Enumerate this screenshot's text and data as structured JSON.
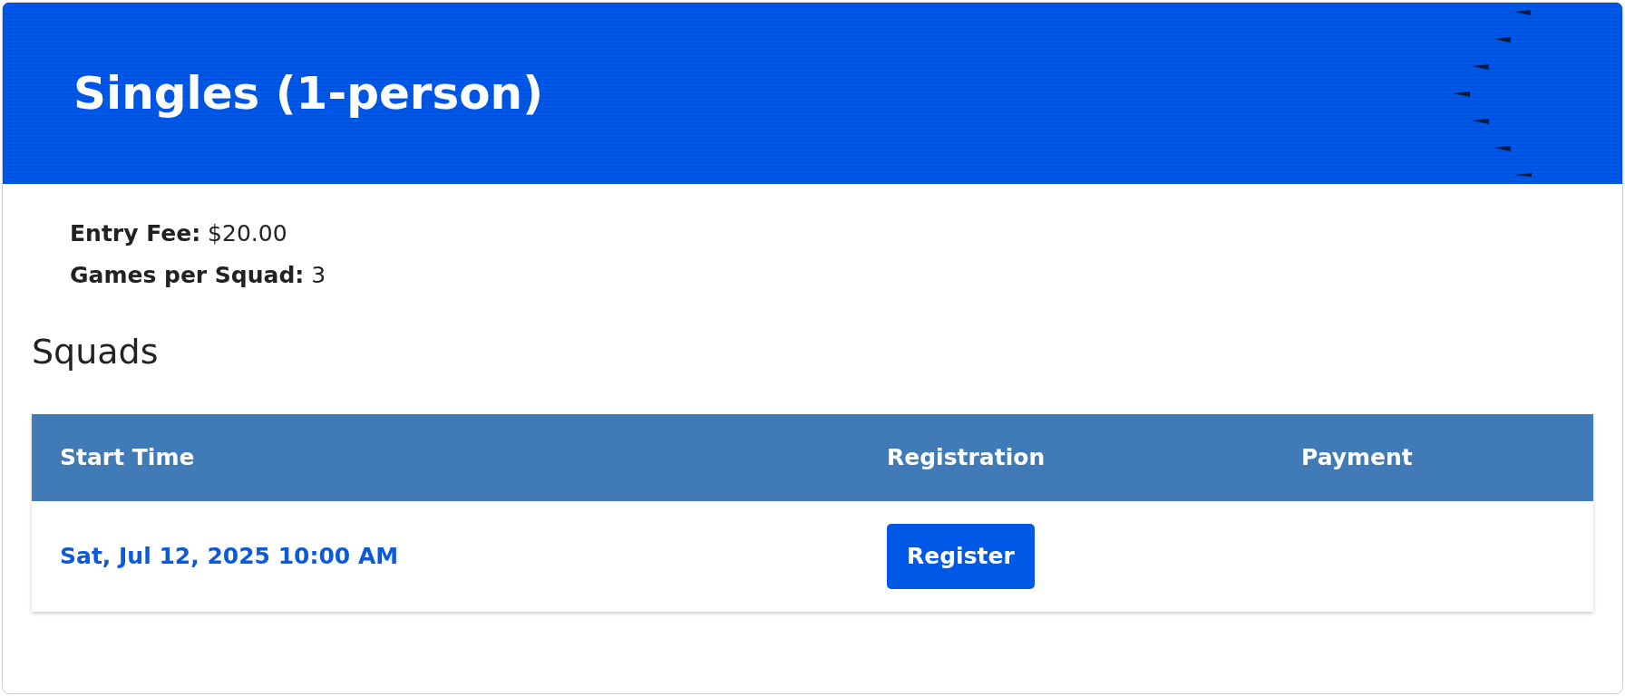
{
  "header": {
    "title": "Singles (1-person)"
  },
  "details": [
    "**Entry Fee:** $20.00",
    "**Games per Squad:** 3"
  ],
  "squads": {
    "heading": "Squads",
    "columns": [
      "Start Time",
      "Registration",
      "Payment"
    ],
    "rows": [
      {
        "start_time": "Sat, Jul 12, 2025 10:00 AM",
        "registration": {
          "label": "Register"
        }
      }
    ]
  }
}
